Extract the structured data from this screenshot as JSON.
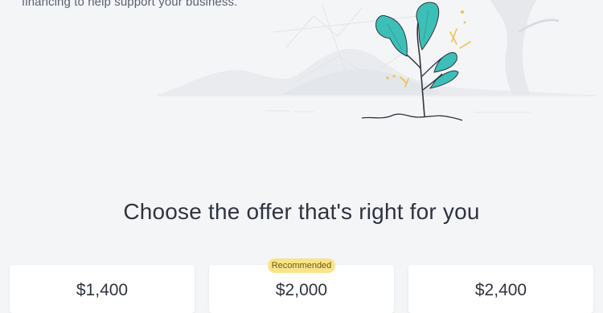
{
  "intro": {
    "text": "financing to help support your business."
  },
  "offers_section": {
    "title": "Choose the offer that's right for you",
    "recommended_badge": "Recommended",
    "offers": [
      {
        "amount": "$1,400"
      },
      {
        "amount": "$2,000"
      },
      {
        "amount": "$2,400"
      }
    ]
  },
  "colors": {
    "background": "#f4f5f7",
    "leaf": "#3dbfb8",
    "badge": "#fbe38a",
    "text": "#2f3440"
  }
}
